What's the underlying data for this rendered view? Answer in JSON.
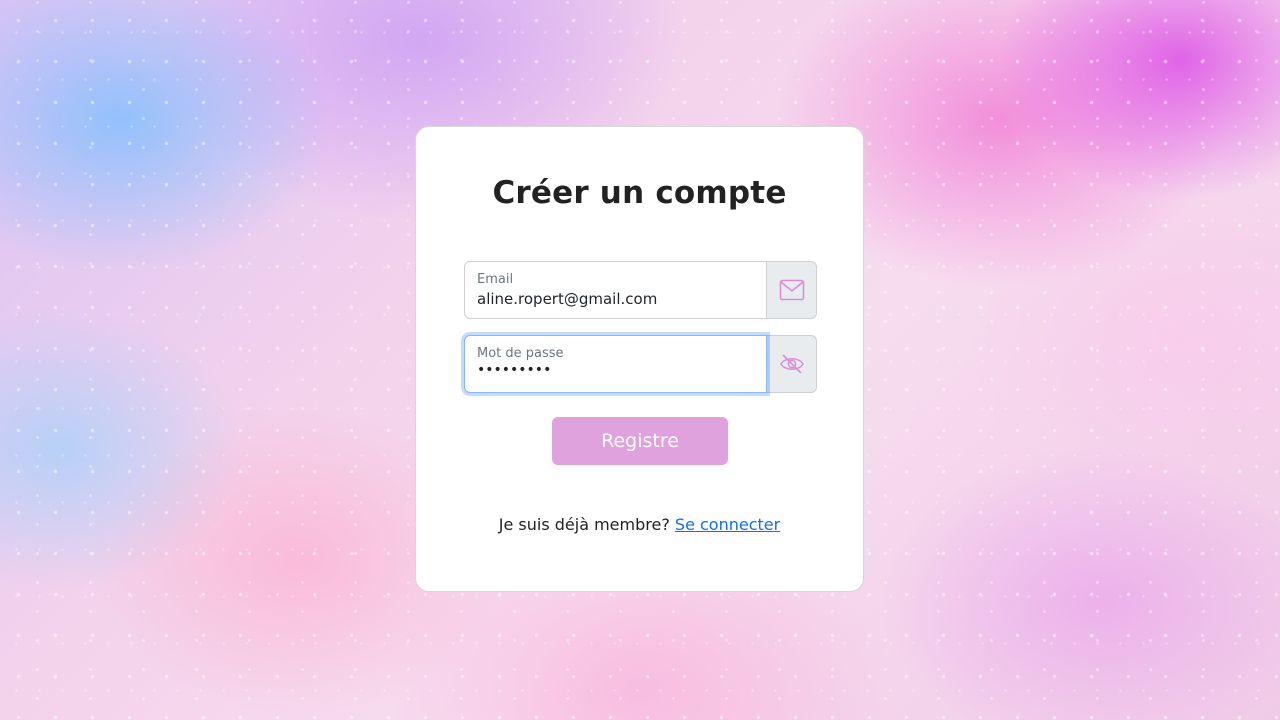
{
  "page": {
    "title": "Créer un compte"
  },
  "form": {
    "email": {
      "label": "Email",
      "value": "aline.ropert@gmail.com",
      "icon": "envelope-icon"
    },
    "password": {
      "label": "Mot de passe",
      "value": "•••••••••",
      "icon": "eye-slash-icon"
    },
    "submit_label": "Registre"
  },
  "footer": {
    "text": "Je suis déjà membre?",
    "link_label": "Se connecter"
  },
  "colors": {
    "accent": "#e0a2dc",
    "icon": "#d98fd6",
    "link": "#0d6efd",
    "focus": "#86b7fe"
  }
}
